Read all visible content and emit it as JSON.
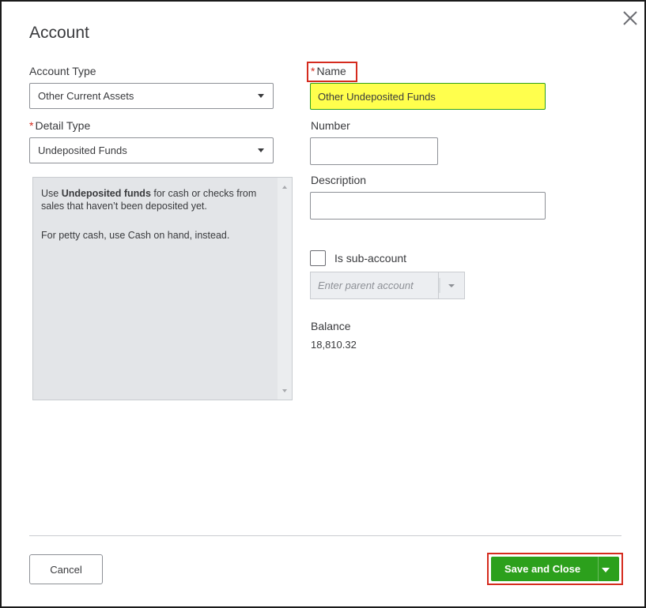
{
  "dialog": {
    "title": "Account",
    "close_icon": "close-icon"
  },
  "left": {
    "account_type_label": "Account Type",
    "account_type_value": "Other Current Assets",
    "detail_type_required": "*",
    "detail_type_label": "Detail Type",
    "detail_type_value": "Undeposited Funds",
    "help": {
      "line1_prefix": "Use ",
      "line1_bold": "Undeposited funds",
      "line1_suffix": " for cash or checks from sales that haven’t been deposited yet.",
      "line2": "For petty cash, use Cash on hand, instead."
    }
  },
  "right": {
    "name_required": "*",
    "name_label": "Name",
    "name_value": "Other Undeposited Funds",
    "number_label": "Number",
    "number_value": "",
    "description_label": "Description",
    "description_value": "",
    "sub_account_label": "Is sub-account",
    "sub_account_checked": false,
    "parent_placeholder": "Enter parent account",
    "balance_label": "Balance",
    "balance_value": "18,810.32"
  },
  "footer": {
    "cancel_label": "Cancel",
    "save_label": "Save and Close"
  },
  "colors": {
    "accent_green": "#2ca01c",
    "highlight_yellow": "#ffff4d",
    "highlight_border_red": "#d52b1e"
  }
}
